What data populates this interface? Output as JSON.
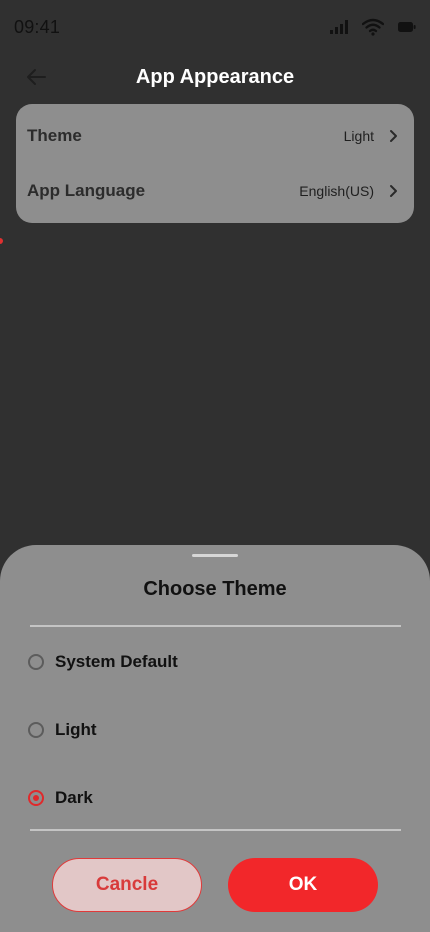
{
  "status_bar": {
    "time": "09:41",
    "icons": [
      "cellular-signal-icon",
      "wifi-icon",
      "battery-icon"
    ]
  },
  "header": {
    "title": "App Appearance",
    "back_icon": "arrow-left-icon"
  },
  "settings": {
    "items": [
      {
        "label": "Theme",
        "value": "Light",
        "icon": "chevron-right-icon"
      },
      {
        "label": "App Language",
        "value": "English(US)",
        "icon": "chevron-right-icon"
      }
    ]
  },
  "theme_sheet": {
    "title": "Choose Theme",
    "options": [
      {
        "label": "System Default",
        "selected": false
      },
      {
        "label": "Light",
        "selected": false
      },
      {
        "label": "Dark",
        "selected": true
      }
    ],
    "cancel_label": "Cancle",
    "ok_label": "OK"
  },
  "colors": {
    "accent": "#f2272a",
    "background": "#303030",
    "card": "#8e8e8e",
    "cancel_fill": "#e2c7c7"
  }
}
